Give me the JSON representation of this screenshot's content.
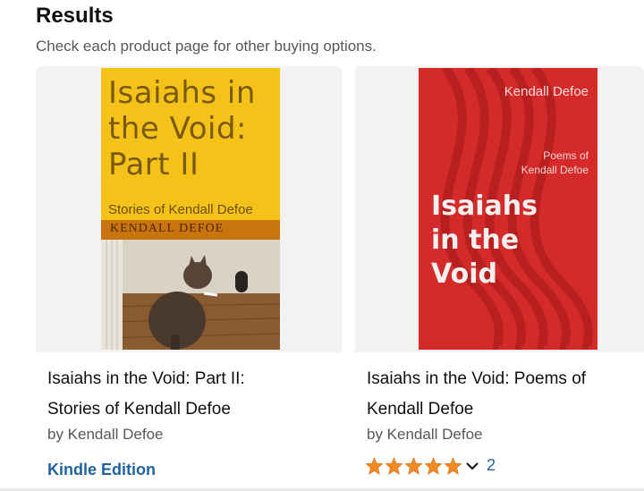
{
  "header": {
    "title": "Results",
    "subtitle": "Check each product page for other buying options."
  },
  "products": [
    {
      "cover": {
        "title": "Isaiahs in the Void: Part II",
        "title_lines": [
          "Isaiahs in",
          "the Void:",
          "Part II"
        ],
        "subtitle": "Stories of Kendall Defoe",
        "author": "KENDALL DEFOE"
      },
      "title_lines": [
        "Isaiahs in the Void: Part II:",
        "Stories of Kendall Defoe"
      ],
      "author": "by Kendall Defoe",
      "format": "Kindle Edition"
    },
    {
      "cover": {
        "author": "Kendall Defoe",
        "poems_lines": [
          "Poems of",
          "Kendall Defoe"
        ],
        "title_lines": [
          "Isaiahs",
          "in the",
          "Void"
        ]
      },
      "title_lines": [
        "Isaiahs in the Void: Poems of",
        "Kendall Defoe"
      ],
      "author": "by Kendall Defoe",
      "rating": {
        "stars": 5,
        "count": "2"
      }
    }
  ],
  "colors": {
    "link": "#2162a1",
    "star": "#f08a24",
    "cover1_bg": "#f5c21a",
    "cover2_bg": "#d42a2a"
  },
  "icons": [
    "star-icon",
    "chevron-down-icon"
  ]
}
